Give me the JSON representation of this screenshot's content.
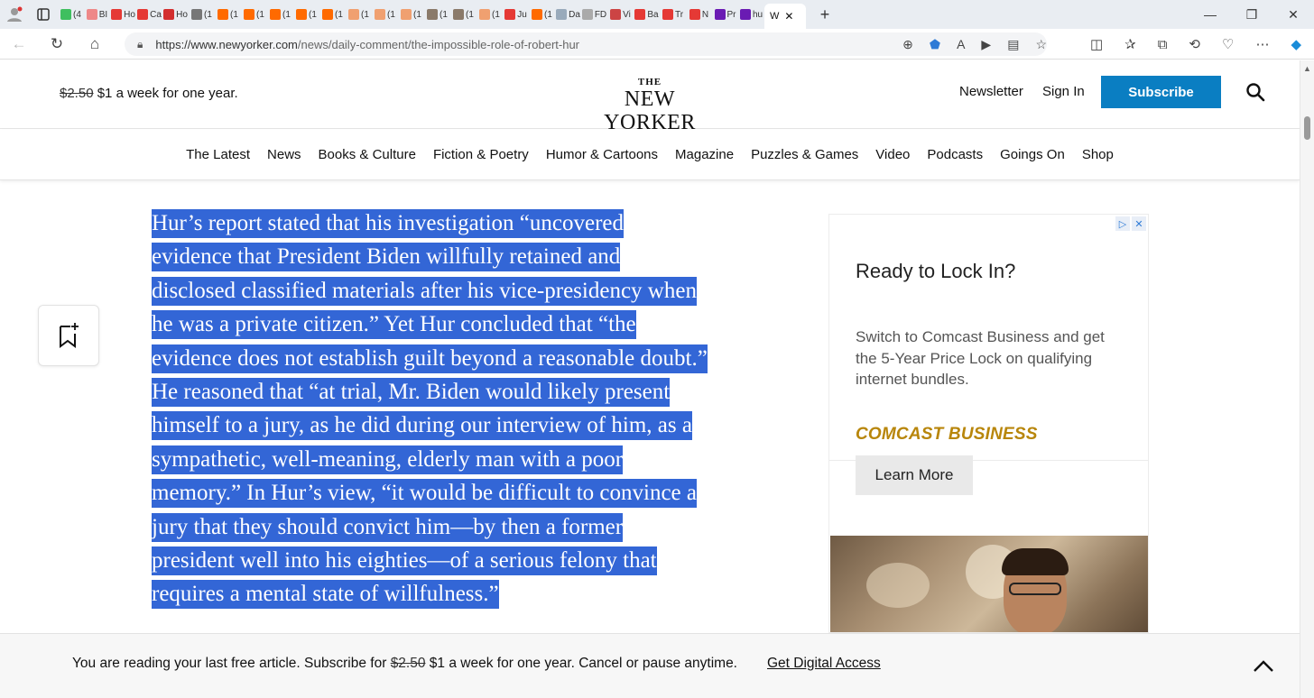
{
  "browser": {
    "tabs": [
      {
        "label": "(4",
        "color": "#3fbf5f"
      },
      {
        "label": "BI",
        "color": "#e88"
      },
      {
        "label": "Ho",
        "color": "#e53935"
      },
      {
        "label": "Ca",
        "color": "#e53935"
      },
      {
        "label": "Ho",
        "color": "#d32f2f"
      },
      {
        "label": "(1",
        "color": "#777"
      },
      {
        "label": "(1",
        "color": "#ff6a00"
      },
      {
        "label": "(1",
        "color": "#ff6a00"
      },
      {
        "label": "(1",
        "color": "#ff6a00"
      },
      {
        "label": "(1",
        "color": "#ff6a00"
      },
      {
        "label": "(1",
        "color": "#ff6a00"
      },
      {
        "label": "(1",
        "color": "#f0a070"
      },
      {
        "label": "(1",
        "color": "#f0a070"
      },
      {
        "label": "(1",
        "color": "#f0a070"
      },
      {
        "label": "(1",
        "color": "#8a7a6a"
      },
      {
        "label": "(1",
        "color": "#8a7a6a"
      },
      {
        "label": "(1",
        "color": "#f0a070"
      },
      {
        "label": "Ju",
        "color": "#e53935"
      },
      {
        "label": "(1",
        "color": "#ff6a00"
      },
      {
        "label": "Da",
        "color": "#9ab"
      },
      {
        "label": "FD",
        "color": "#aaa"
      },
      {
        "label": "Vi",
        "color": "#c44"
      },
      {
        "label": "Ba",
        "color": "#e53935"
      },
      {
        "label": "Tr",
        "color": "#e53935"
      },
      {
        "label": "N",
        "color": "#e53935"
      },
      {
        "label": "Pr",
        "color": "#6a1bb3"
      },
      {
        "label": "hu",
        "color": "#6a1bb3"
      }
    ],
    "active_tab_label": "W",
    "url_domain": "https://www.newyorker.com",
    "url_path": "/news/daily-comment/the-impossible-role-of-robert-hur"
  },
  "header": {
    "promo_old_price": "$2.50",
    "promo_text": "$1 a week for one year.",
    "logo_the": "THE",
    "logo_name": "NEW YORKER",
    "newsletter": "Newsletter",
    "sign_in": "Sign In",
    "subscribe": "Subscribe"
  },
  "nav": [
    "The Latest",
    "News",
    "Books & Culture",
    "Fiction & Poetry",
    "Humor & Cartoons",
    "Magazine",
    "Puzzles & Games",
    "Video",
    "Podcasts",
    "Goings On",
    "Shop"
  ],
  "article": {
    "lines": [
      "Hur’s report stated that his investigation “uncovered",
      "evidence that President Biden willfully retained and",
      "disclosed classified materials after his vice-presidency when",
      "he was a private citizen.” Yet Hur concluded that “the",
      "evidence does not establish guilt beyond a reasonable doubt.”",
      "He reasoned that “at trial, Mr. Biden would likely present",
      "himself to a jury, as he did during our interview of him, as a",
      "sympathetic, well-meaning, elderly man with a poor",
      "memory.” In Hur’s view, “it would be difficult to convince a",
      "jury that they should convict him—by then a former",
      "president well into his eighties—of a serious felony that",
      "requires a mental state of willfulness.”"
    ],
    "highlight_color": "#3366d6"
  },
  "ad": {
    "title": "Ready to Lock In?",
    "body": "Switch to Comcast Business and get the 5-Year Price Lock on qualifying internet bundles.",
    "brand": "COMCAST BUSINESS",
    "cta": "Learn More",
    "brand_color": "#b8860b"
  },
  "bottom_bar": {
    "text_before": "You are reading your last free article. Subscribe for",
    "old_price": "$2.50",
    "text_after": "$1 a week for one year. Cancel or pause anytime.",
    "link": "Get Digital Access"
  },
  "colors": {
    "subscribe_blue": "#0a7ec2"
  }
}
